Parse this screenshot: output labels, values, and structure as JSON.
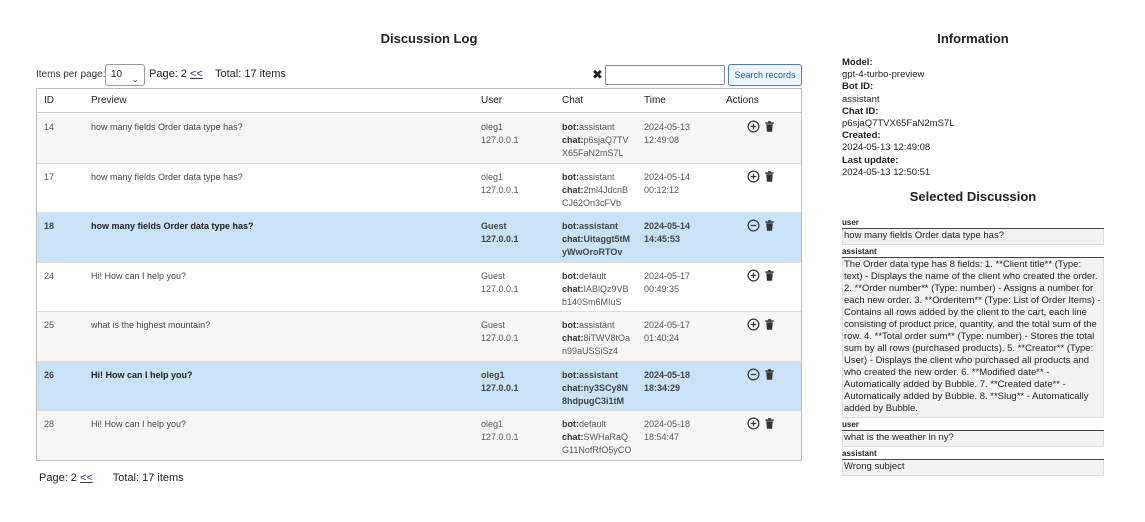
{
  "log": {
    "title": "Discussion Log",
    "items_per_page_label": "Items per page:",
    "items_per_page_value": "10",
    "page_label": "Page: 2",
    "prev_link": "<<",
    "total": "Total: 17 items",
    "clear_glyph": "✖",
    "search_placeholder": "",
    "search_button": "Search records",
    "headers": [
      "ID",
      "Preview",
      "User",
      "Chat",
      "Time",
      "Actions"
    ],
    "rows": [
      {
        "id": "14",
        "preview": "how many fields Order data type has?",
        "user": "oleg1",
        "ip": "127.0.0.1",
        "bot_label": "bot:",
        "bot": "assistant",
        "chat_label": "chat:",
        "chat": "p6sjaQ7TVX65FaN2mS7L",
        "date": "2024-05-13",
        "time": "12:49:08",
        "selected": false
      },
      {
        "id": "17",
        "preview": "how many fields Order data type has?",
        "user": "oleg1",
        "ip": "127.0.0.1",
        "bot_label": "bot:",
        "bot": "assistant",
        "chat_label": "chat:",
        "chat": "2ml4JdcnBCJ62On3cFVb",
        "date": "2024-05-14",
        "time": "00:12:12",
        "selected": false
      },
      {
        "id": "18",
        "preview": "how many fields Order data type has?",
        "user": "Guest",
        "ip": "127.0.0.1",
        "bot_label": "bot:",
        "bot": "assistant",
        "chat_label": "chat:",
        "chat": "Uitaggt5tMyWwOroRTOv",
        "date": "2024-05-14",
        "time": "14:45:53",
        "selected": true
      },
      {
        "id": "24",
        "preview": "Hi! How can I help you?",
        "user": "Guest",
        "ip": "127.0.0.1",
        "bot_label": "bot:",
        "bot": "default",
        "chat_label": "chat:",
        "chat": "IABlQz9VBb140Sm6MIuS",
        "date": "2024-05-17",
        "time": "00:49:35",
        "selected": false
      },
      {
        "id": "25",
        "preview": "what is the highest mountain?",
        "user": "Guest",
        "ip": "127.0.0.1",
        "bot_label": "bot:",
        "bot": "assistant",
        "chat_label": "chat:",
        "chat": "8iTWV8tOan99aUSSiSz4",
        "date": "2024-05-17",
        "time": "01:40:24",
        "selected": false
      },
      {
        "id": "26",
        "preview": "Hi! How can I help you?",
        "user": "oleg1",
        "ip": "127.0.0.1",
        "bot_label": "bot:",
        "bot": "assistant",
        "chat_label": "chat:",
        "chat": "ny3SCy8N8hdpugC3i1tM",
        "date": "2024-05-18",
        "time": "18:34:29",
        "selected": true
      },
      {
        "id": "28",
        "preview": "Hi! How can I help you?",
        "user": "oleg1",
        "ip": "127.0.0.1",
        "bot_label": "bot:",
        "bot": "default",
        "chat_label": "chat:",
        "chat": "SWHaRaQG11NofRfO5yCO",
        "date": "2024-05-18",
        "time": "18:54:47",
        "selected": false
      }
    ]
  },
  "info": {
    "title": "Information",
    "model_label": "Model:",
    "model": "gpt-4-turbo-preview",
    "bot_label": "Bot ID:",
    "bot": "assistant",
    "chat_label": "Chat ID:",
    "chat": "p6sjaQ7TVX65FaN2mS7L",
    "created_label": "Created:",
    "created": "2024-05-13 12:49:08",
    "updated_label": "Last update:",
    "updated": "2024-05-13 12:50:51"
  },
  "selected": {
    "title": "Selected Discussion",
    "messages": [
      {
        "role": "user",
        "text": "how many fields Order data type has?"
      },
      {
        "role": "assistant",
        "text": "The Order data type has 8 fields: 1. **Client title** (Type: text) - Displays the name of the client who created the order. 2. **Order number** (Type: number) - Assigns a number for each new order. 3. **Orderitem** (Type: List of Order Items) - Contains all rows added by the client to the cart, each line consisting of product price, quantity, and the total sum of the row. 4. **Total order sum** (Type: number) - Stores the total sum by all rows (purchased products). 5. **Creator** (Type: User) - Displays the client who purchased all products and who created the new order. 6. **Modified date** - Automatically added by Bubble. 7. **Created date** - Automatically added by Bubble. 8. **Slug** - Automatically added by Bubble."
      },
      {
        "role": "user",
        "text": "what is the weather in ny?"
      },
      {
        "role": "assistant",
        "text": "Wrong subject"
      }
    ]
  },
  "colors": {
    "selected_row": "#c9e2f5",
    "odd_row": "#f5f6f5",
    "button_border": "#4a7fb5"
  },
  "icons": {
    "expand": "plus-circle-icon",
    "collapse": "minus-circle-icon",
    "delete": "trash-icon"
  }
}
